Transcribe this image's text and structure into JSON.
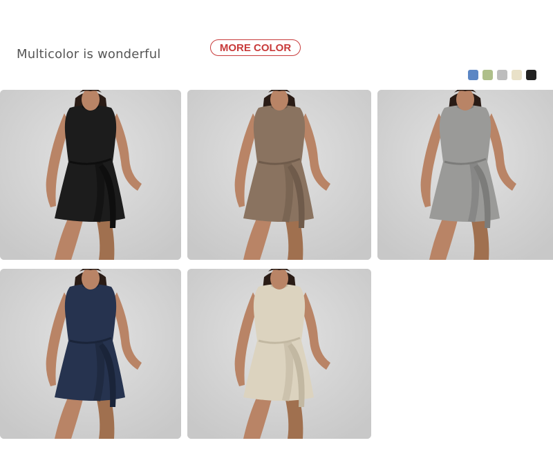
{
  "header": {
    "headline": "Multicolor is wonderful",
    "more_color_label": "MORE COLOR",
    "accent_color": "#c83a3a"
  },
  "swatches": [
    {
      "name": "blue",
      "color": "#5b86c4"
    },
    {
      "name": "sage",
      "color": "#aebf8a"
    },
    {
      "name": "grey",
      "color": "#bdbdbd"
    },
    {
      "name": "cream",
      "color": "#e9e1c8"
    },
    {
      "name": "black",
      "color": "#222222"
    }
  ],
  "products": [
    {
      "color_name": "black",
      "dress": "#1c1c1c",
      "shade": "#0e0e0e"
    },
    {
      "color_name": "khaki",
      "dress": "#8a7360",
      "shade": "#6f5b4b"
    },
    {
      "color_name": "grey",
      "dress": "#9a9a98",
      "shade": "#7c7c7a"
    },
    {
      "color_name": "navy",
      "dress": "#26334f",
      "shade": "#1a2439"
    },
    {
      "color_name": "cream",
      "dress": "#dcd3bf",
      "shade": "#c2b8a2"
    }
  ]
}
